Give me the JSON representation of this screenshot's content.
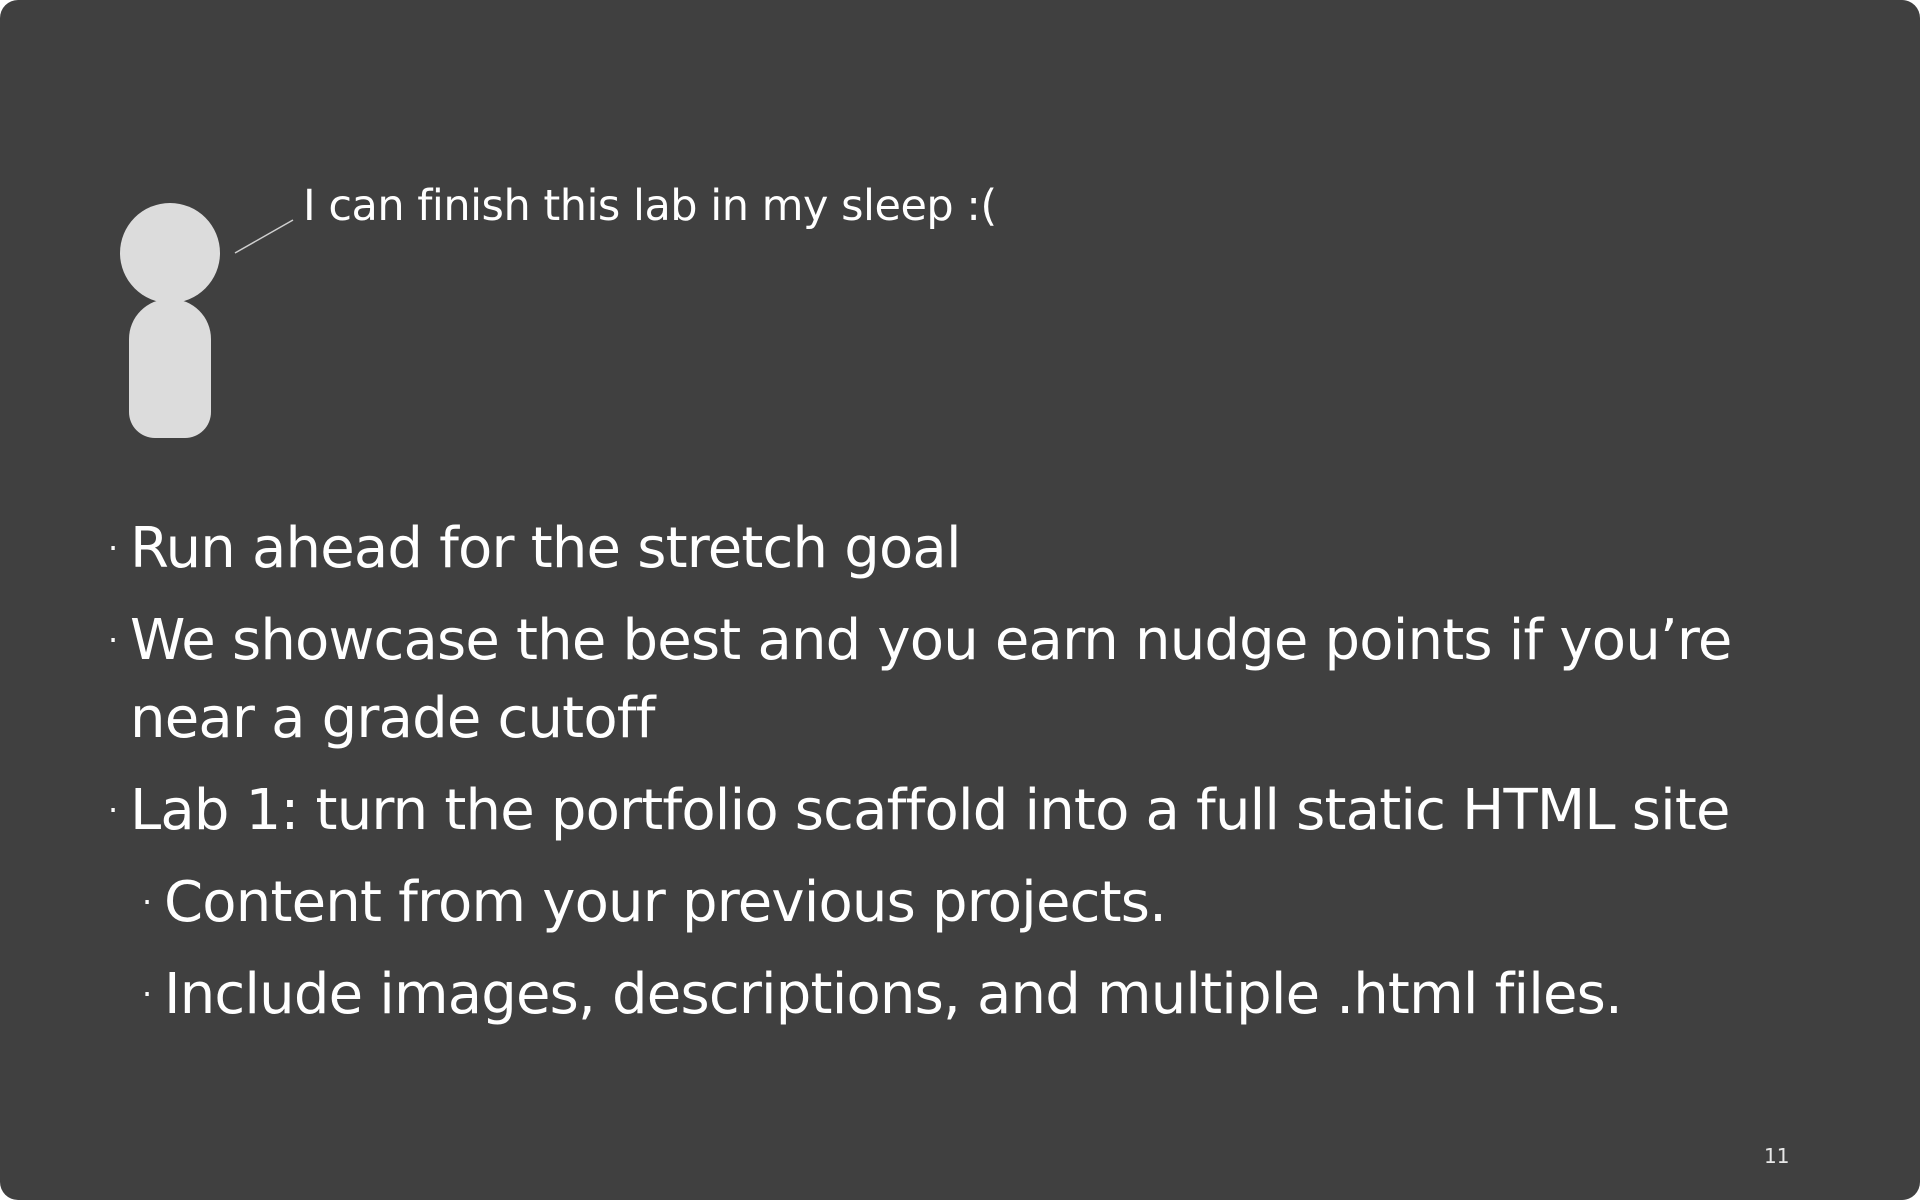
{
  "slide": {
    "speech": "I can finish this lab in my sleep :(",
    "bullets": [
      {
        "text": "Run ahead for the stretch goal",
        "level": 1
      },
      {
        "text": "We showcase the best and you earn nudge points if you’re near a grade cutoff",
        "level": 1
      },
      {
        "text": "Lab 1: turn the portfolio scaffold into a full static HTML site",
        "level": 1
      },
      {
        "text": "Content from your previous projects.",
        "level": 2
      },
      {
        "text": "Include images, descriptions, and multiple .html files.",
        "level": 2
      }
    ],
    "bullet_glyph": "·",
    "page_number": "11"
  },
  "colors": {
    "background": "#404040",
    "figure": "#dcdcdc",
    "text": "#ffffff"
  },
  "icons": {
    "figure": "person-silhouette-icon"
  }
}
